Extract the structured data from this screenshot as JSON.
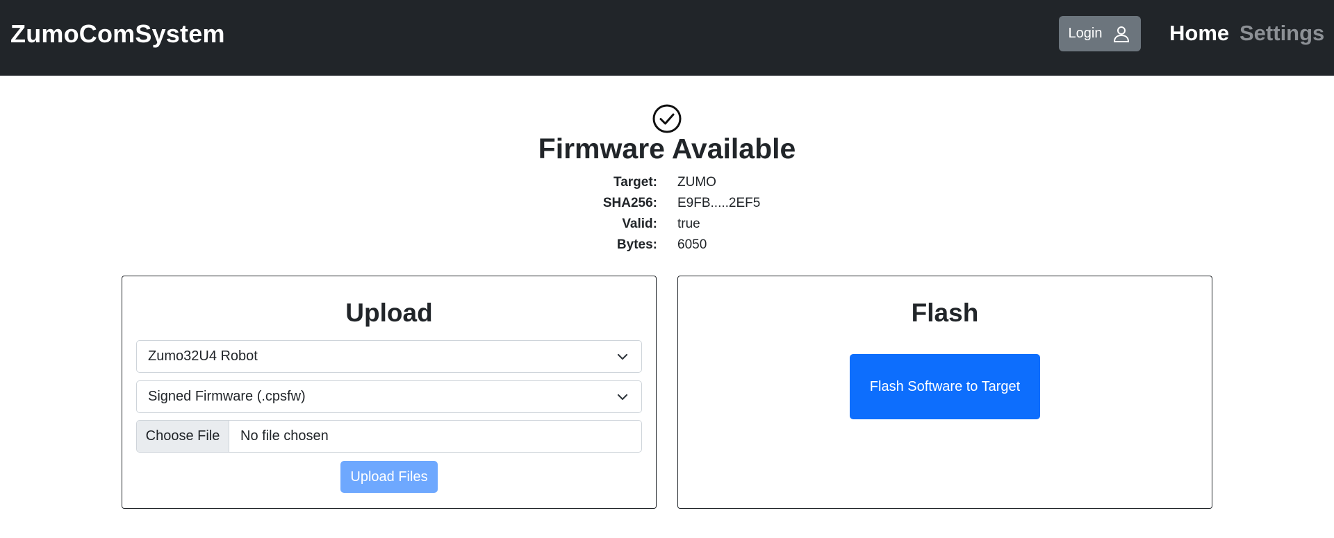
{
  "navbar": {
    "brand": "ZumoComSystem",
    "login_label": "Login",
    "login_icon": "person-icon",
    "links": {
      "home": "Home",
      "settings": "Settings"
    },
    "background_color": "#212529"
  },
  "status": {
    "icon": "check-circle-icon",
    "title": "Firmware Available",
    "info": [
      {
        "key": "Target:",
        "value": "ZUMO"
      },
      {
        "key": "SHA256:",
        "value": "E9FB.....2EF5"
      },
      {
        "key": "Valid:",
        "value": "true"
      },
      {
        "key": "Bytes:",
        "value": "6050"
      }
    ]
  },
  "upload": {
    "title": "Upload",
    "target_select": {
      "selected": "Zumo32U4 Robot"
    },
    "type_select": {
      "selected": "Signed Firmware (.cpsfw)"
    },
    "file_input": {
      "button_label": "Choose File",
      "status_text": "No file chosen"
    },
    "upload_button_label": "Upload Files",
    "upload_button_color": "#6ea8fe"
  },
  "flash": {
    "title": "Flash",
    "button_label": "Flash Software to Target",
    "button_color": "#0d6efd"
  }
}
